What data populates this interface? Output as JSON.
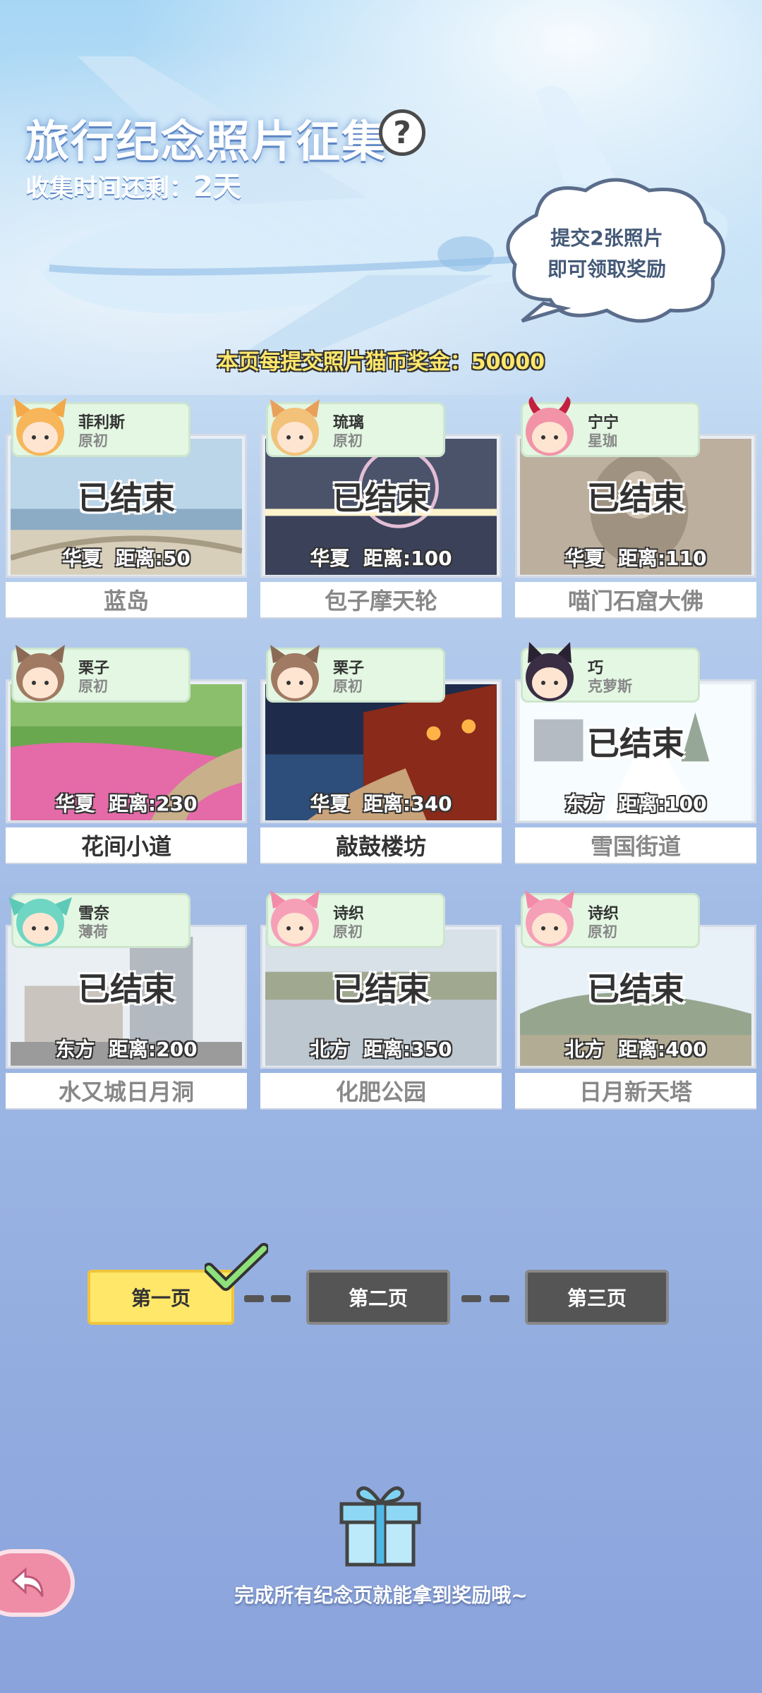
{
  "header": {
    "title": "旅行纪念照片征集",
    "help_symbol": "?",
    "timer_label": "收集时间还剩：",
    "timer_value": "2天",
    "cloud_line1": "提交2张照片",
    "cloud_line2": "即可领取奖励",
    "bonus_text": "本页每提交照片猫币奖金：50000"
  },
  "cards": [
    {
      "char": "菲利斯",
      "sub": "原初",
      "status": "已结束",
      "region": "华夏",
      "dist": "距离:50",
      "place": "蓝岛",
      "ended": true
    },
    {
      "char": "琉璃",
      "sub": "原初",
      "status": "已结束",
      "region": "华夏",
      "dist": "距离:100",
      "place": "包子摩天轮",
      "ended": true
    },
    {
      "char": "宁宁",
      "sub": "星珈",
      "status": "已结束",
      "region": "华夏",
      "dist": "距离:110",
      "place": "喵门石窟大佛",
      "ended": true
    },
    {
      "char": "栗子",
      "sub": "原初",
      "status": "",
      "region": "华夏",
      "dist": "距离:230",
      "place": "花间小道",
      "ended": false
    },
    {
      "char": "栗子",
      "sub": "原初",
      "status": "",
      "region": "华夏",
      "dist": "距离:340",
      "place": "敲鼓楼坊",
      "ended": false
    },
    {
      "char": "巧",
      "sub": "克萝斯",
      "status": "已结束",
      "region": "东方",
      "dist": "距离:100",
      "place": "雪国街道",
      "ended": true
    },
    {
      "char": "雪奈",
      "sub": "薄荷",
      "status": "已结束",
      "region": "东方",
      "dist": "距离:200",
      "place": "水又城日月洞",
      "ended": true
    },
    {
      "char": "诗织",
      "sub": "原初",
      "status": "已结束",
      "region": "北方",
      "dist": "距离:350",
      "place": "化肥公园",
      "ended": true
    },
    {
      "char": "诗织",
      "sub": "原初",
      "status": "已结束",
      "region": "北方",
      "dist": "距离:400",
      "place": "日月新天塔",
      "ended": true
    }
  ],
  "pager": {
    "page1": "第一页",
    "page2": "第二页",
    "page3": "第三页"
  },
  "footer": {
    "text": "完成所有纪念页就能拿到奖励哦~"
  },
  "colors": {
    "accent_yellow": "#ffe76a",
    "tag_green": "#e3f7e3",
    "back_pink": "#ef8ca6"
  }
}
